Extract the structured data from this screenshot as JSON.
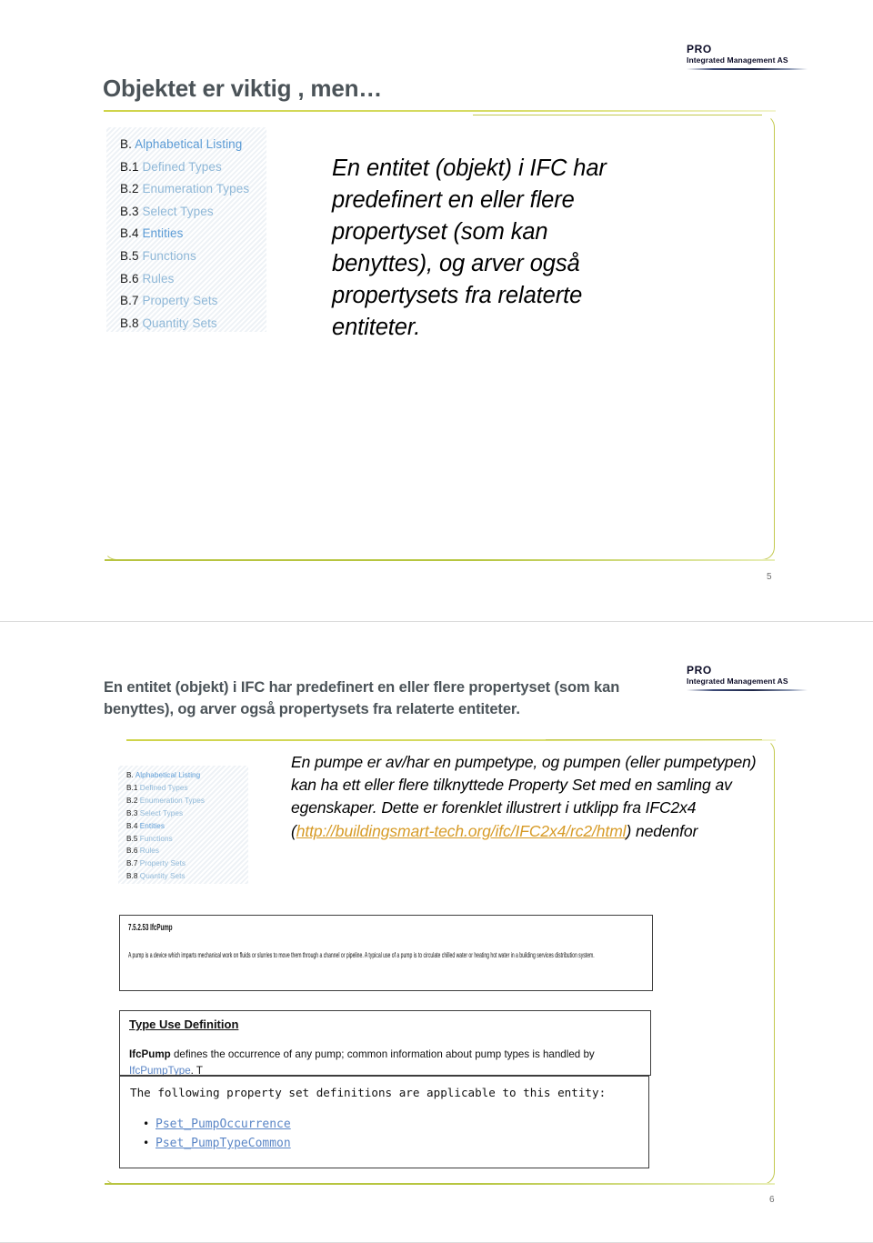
{
  "logo": {
    "name": "PRO",
    "tagline": "Integrated Management AS"
  },
  "slide1": {
    "title": "Objektet er viktig , men…",
    "body": "En entitet (objekt) i IFC har predefinert en eller flere propertyset (som kan benyttes), og arver også propertysets fra relaterte entiteter.",
    "page_number": "5",
    "ifc_list": [
      {
        "num": "B.",
        "label": "Alphabetical Listing",
        "dim": false
      },
      {
        "num": "B.1",
        "label": "Defined Types",
        "dim": true
      },
      {
        "num": "B.2",
        "label": "Enumeration Types",
        "dim": true
      },
      {
        "num": "B.3",
        "label": "Select Types",
        "dim": true
      },
      {
        "num": "B.4",
        "label": "Entities",
        "dim": false
      },
      {
        "num": "B.5",
        "label": "Functions",
        "dim": true
      },
      {
        "num": "B.6",
        "label": "Rules",
        "dim": true
      },
      {
        "num": "B.7",
        "label": "Property Sets",
        "dim": true
      },
      {
        "num": "B.8",
        "label": "Quantity Sets",
        "dim": true
      }
    ]
  },
  "slide2": {
    "title": "En entitet (objekt) i IFC har predefinert en eller flere propertyset (som kan benyttes), og arver også propertysets fra relaterte entiteter.",
    "body_part1": "En pumpe er av/har en pumpetype, og pumpen (eller pumpetypen) kan ha ett eller flere tilknyttede Property Set med en samling av egenskaper. Dette er forenklet illustrert i utklipp fra IFC2x4 (",
    "body_link": "http://buildingsmart-tech.org/ifc/IFC2x4/rc2/html",
    "body_part2": ") nedenfor",
    "page_number": "6",
    "ifc_list": [
      {
        "num": "B.",
        "label": "Alphabetical Listing",
        "dim": false
      },
      {
        "num": "B.1",
        "label": "Defined Types",
        "dim": true
      },
      {
        "num": "B.2",
        "label": "Enumeration Types",
        "dim": true
      },
      {
        "num": "B.3",
        "label": "Select Types",
        "dim": true
      },
      {
        "num": "B.4",
        "label": "Entities",
        "dim": false
      },
      {
        "num": "B.5",
        "label": "Functions",
        "dim": true
      },
      {
        "num": "B.6",
        "label": "Rules",
        "dim": true
      },
      {
        "num": "B.7",
        "label": "Property Sets",
        "dim": true
      },
      {
        "num": "B.8",
        "label": "Quantity Sets",
        "dim": true
      }
    ],
    "doc_excerpt": {
      "section_heading": "7.5.2.53 IfcPump",
      "section_paragraph": "A pump is a device which imparts mechanical work on fluids or slurries to move them through a channel or pipeline. A typical use of a pump is to circulate chilled water or heating hot water in a building services distribution system.",
      "type_use_heading": "Type Use Definition",
      "type_use_entity": "IfcPump",
      "type_use_text_1": " defines the occurrence of any pump; common information about pump types is handled by ",
      "type_use_link": "IfcPumpType",
      "type_use_text_2": ". T",
      "pset_lead": "The following property set definitions are applicable to this entity:",
      "pset_items": [
        "Pset_PumpOccurrence",
        "Pset_PumpTypeCommon"
      ]
    }
  },
  "colors": {
    "title_gray": "#4b5358",
    "accent_green": "#c3c94e",
    "link_orange": "#d79b27",
    "link_blue": "#5b86c6",
    "ifc_blue": "#5b9bd5"
  }
}
